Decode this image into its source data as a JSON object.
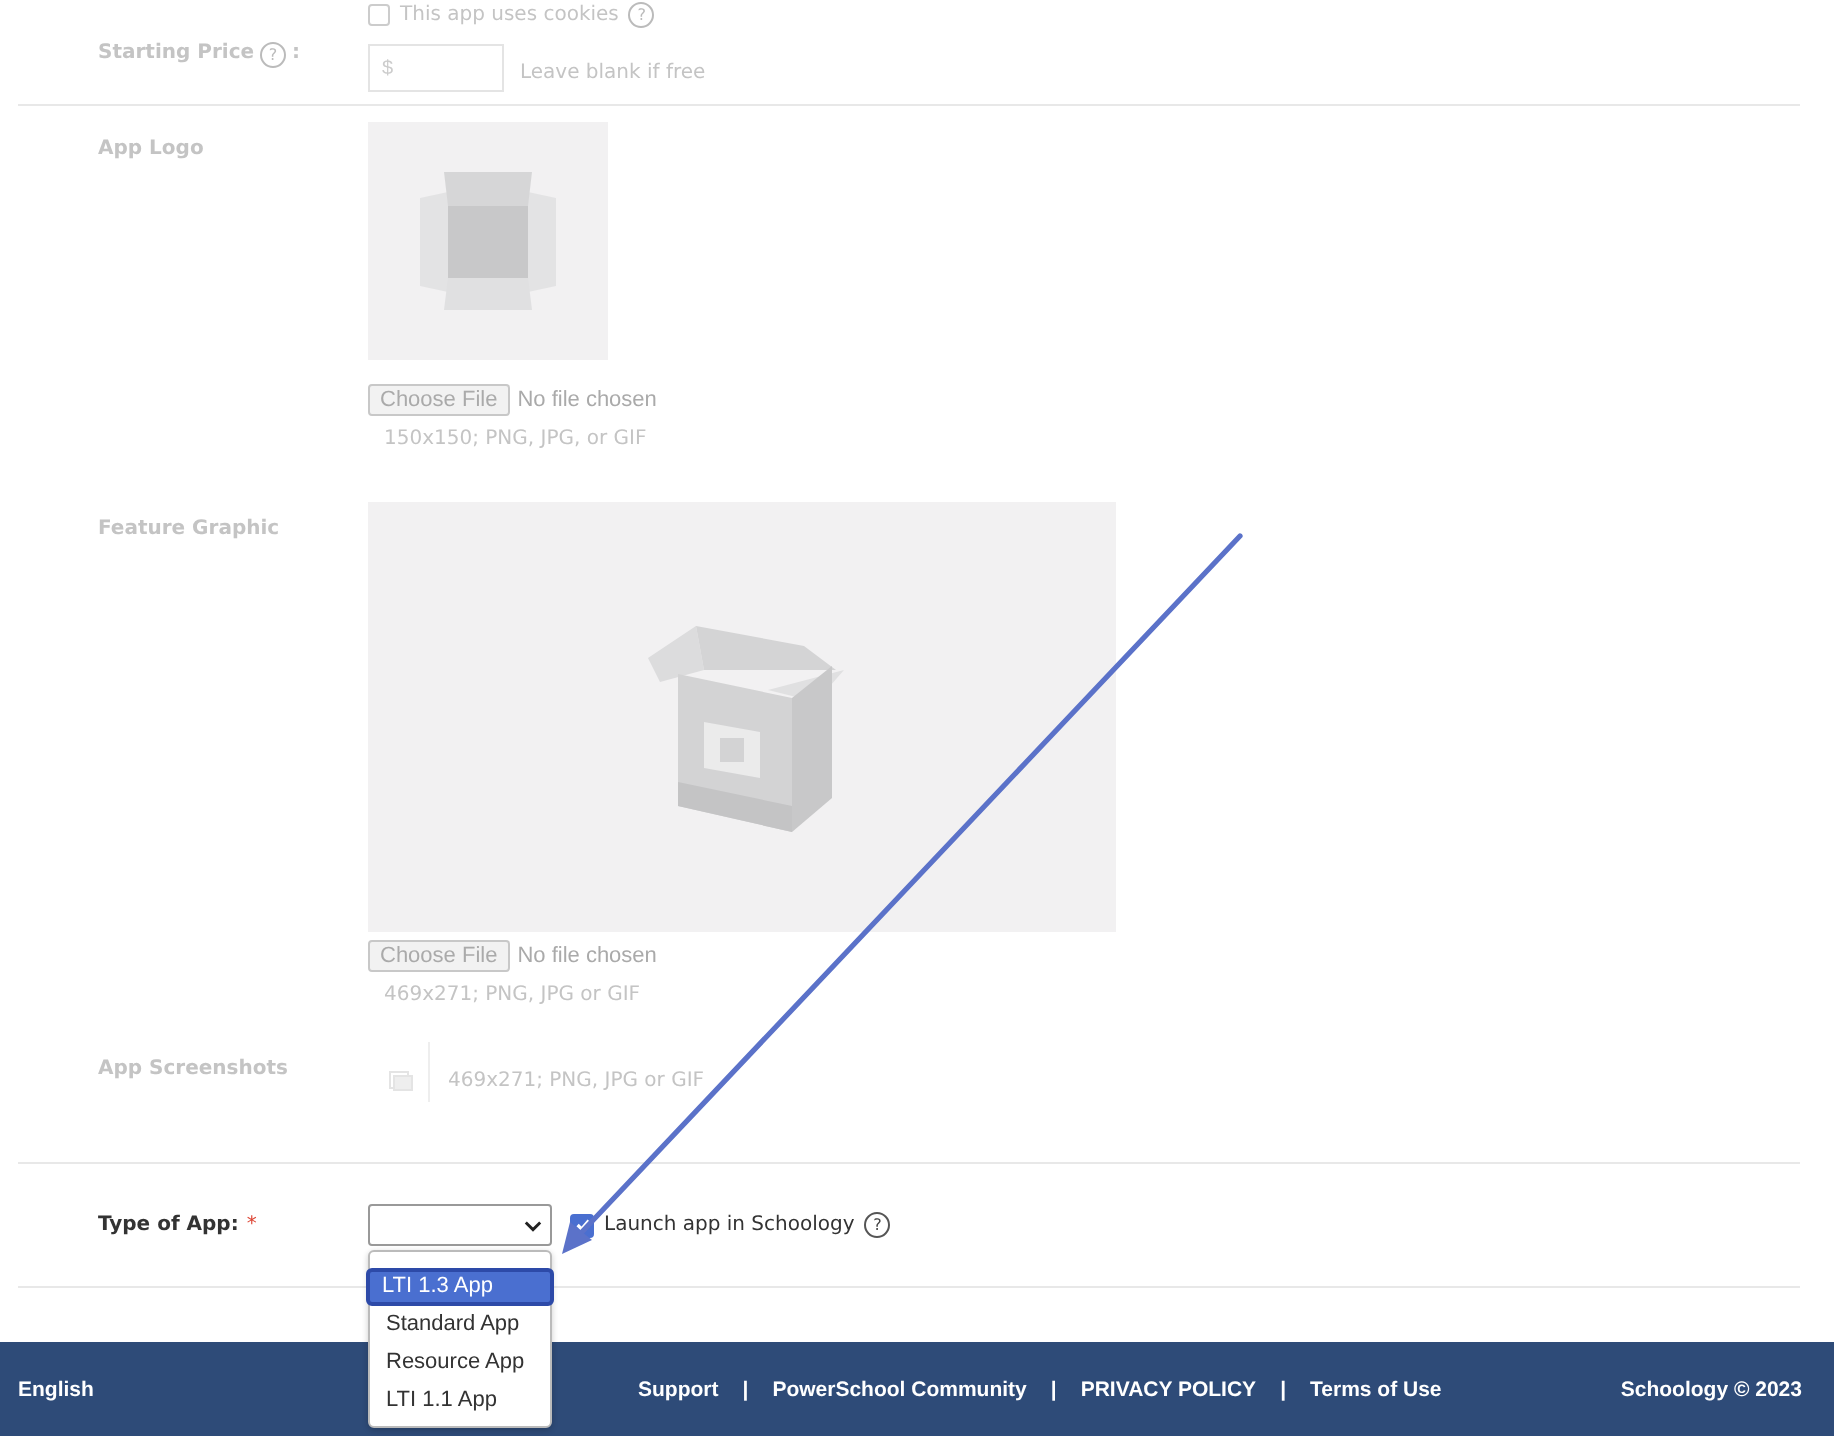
{
  "cookies": {
    "label": "This app uses cookies",
    "checked": false,
    "help": "?"
  },
  "starting_price": {
    "label": "Starting Price",
    "help": "?",
    "colon": ":",
    "placeholder": "$",
    "hint": "Leave blank if free"
  },
  "app_logo": {
    "label": "App Logo",
    "button": "Choose File",
    "file_status": "No file chosen",
    "hint": "150x150; PNG, JPG, or GIF"
  },
  "feature_graphic": {
    "label": "Feature Graphic",
    "button": "Choose File",
    "file_status": "No file chosen",
    "hint": "469x271; PNG, JPG or GIF"
  },
  "app_screenshots": {
    "label": "App Screenshots",
    "hint": "469x271; PNG, JPG or GIF"
  },
  "type_of_app": {
    "label": "Type of App:",
    "required_mark": "*",
    "options": [
      {
        "label": "LTI 1.3 App",
        "selected": true
      },
      {
        "label": "Standard App",
        "selected": false
      },
      {
        "label": "Resource App",
        "selected": false
      },
      {
        "label": "LTI 1.1 App",
        "selected": false
      }
    ],
    "launch": {
      "label": "Launch app in Schoology",
      "checked": true,
      "help": "?"
    }
  },
  "footer": {
    "language": "English",
    "links": [
      {
        "label": "Support"
      },
      {
        "label": "PowerSchool Community"
      },
      {
        "label": "PRIVACY POLICY"
      },
      {
        "label": "Terms of Use"
      }
    ],
    "separators": [
      "|",
      "|",
      "|"
    ],
    "copyright": "Schoology © 2023"
  }
}
